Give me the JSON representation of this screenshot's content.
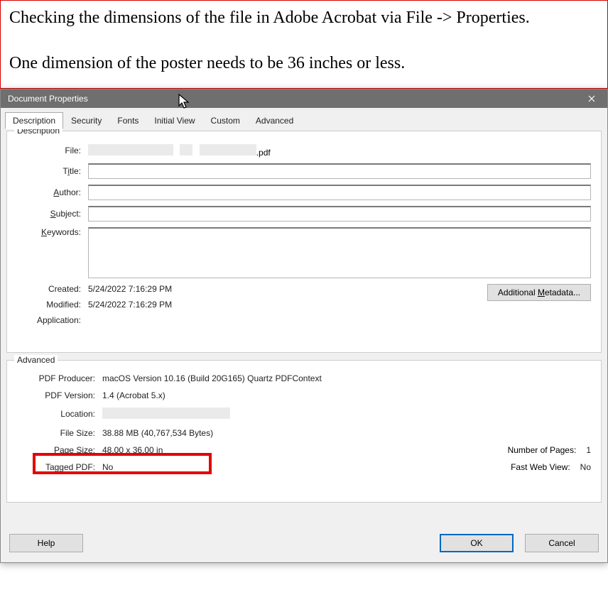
{
  "intro": {
    "line1": "Checking the dimensions of the file in Adobe Acrobat via File -> Properties.",
    "line2": "One dimension of the poster needs to be 36 inches or less."
  },
  "dialog": {
    "title": "Document Properties",
    "tabs": {
      "description": "Description",
      "security": "Security",
      "fonts": "Fonts",
      "initial_view": "Initial View",
      "custom": "Custom",
      "advanced": "Advanced"
    },
    "groups": {
      "description_legend": "Description",
      "advanced_legend": "Advanced"
    },
    "fields": {
      "file_label": "File:",
      "file_ext": ".pdf",
      "title_label_pre": "T",
      "title_label_ul": "i",
      "title_label_post": "tle:",
      "author_label_ul": "A",
      "author_label_post": "uthor:",
      "subject_label_ul": "S",
      "subject_label_post": "ubject:",
      "keywords_label_ul": "K",
      "keywords_label_post": "eywords:",
      "created_label": "Created:",
      "created_value": "5/24/2022 7:16:29 PM",
      "modified_label": "Modified:",
      "modified_value": "5/24/2022 7:16:29 PM",
      "application_label": "Application:",
      "metadata_btn_pre": "Additional ",
      "metadata_btn_ul": "M",
      "metadata_btn_post": "etadata..."
    },
    "advanced": {
      "producer_label": "PDF Producer:",
      "producer_value": "macOS Version 10.16 (Build 20G165) Quartz PDFContext",
      "version_label": "PDF Version:",
      "version_value": "1.4 (Acrobat 5.x)",
      "location_label": "Location:",
      "filesize_label": "File Size:",
      "filesize_value": "38.88 MB (40,767,534 Bytes)",
      "pagesize_label": "Page Size:",
      "pagesize_value": "48.00 x 36.00 in",
      "numpages_label": "Number of Pages:",
      "numpages_value": "1",
      "tagged_label": "Tagged PDF:",
      "tagged_value": "No",
      "fastweb_label": "Fast Web View:",
      "fastweb_value": "No"
    },
    "buttons": {
      "help": "Help",
      "ok": "OK",
      "cancel": "Cancel"
    }
  }
}
